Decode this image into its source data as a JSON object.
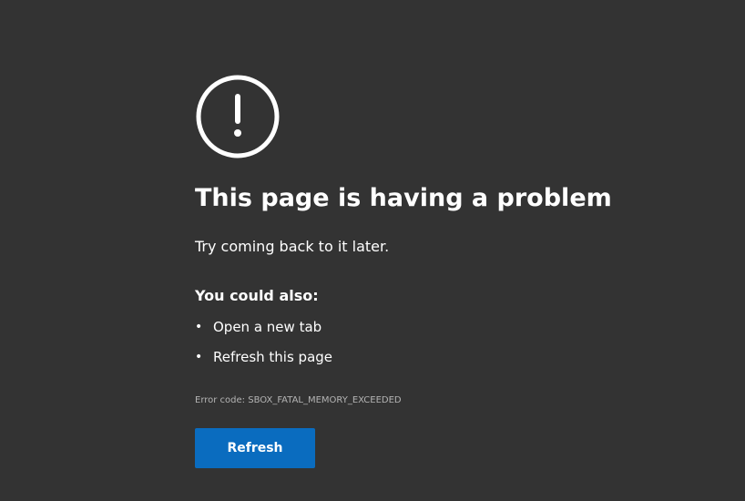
{
  "error_page": {
    "icon": "alert-circle-icon",
    "title": "This page is having a problem",
    "subtitle": "Try coming back to it later.",
    "also_heading": "You could also:",
    "suggestions": [
      {
        "label": "Open a new tab"
      },
      {
        "label": "Refresh this page"
      }
    ],
    "error_code": "Error code: SBOX_FATAL_MEMORY_EXCEEDED",
    "refresh_label": "Refresh"
  },
  "colors": {
    "background": "#333333",
    "text": "#ffffff",
    "muted_text": "#b4b4b4",
    "button": "#0a6cbf"
  }
}
